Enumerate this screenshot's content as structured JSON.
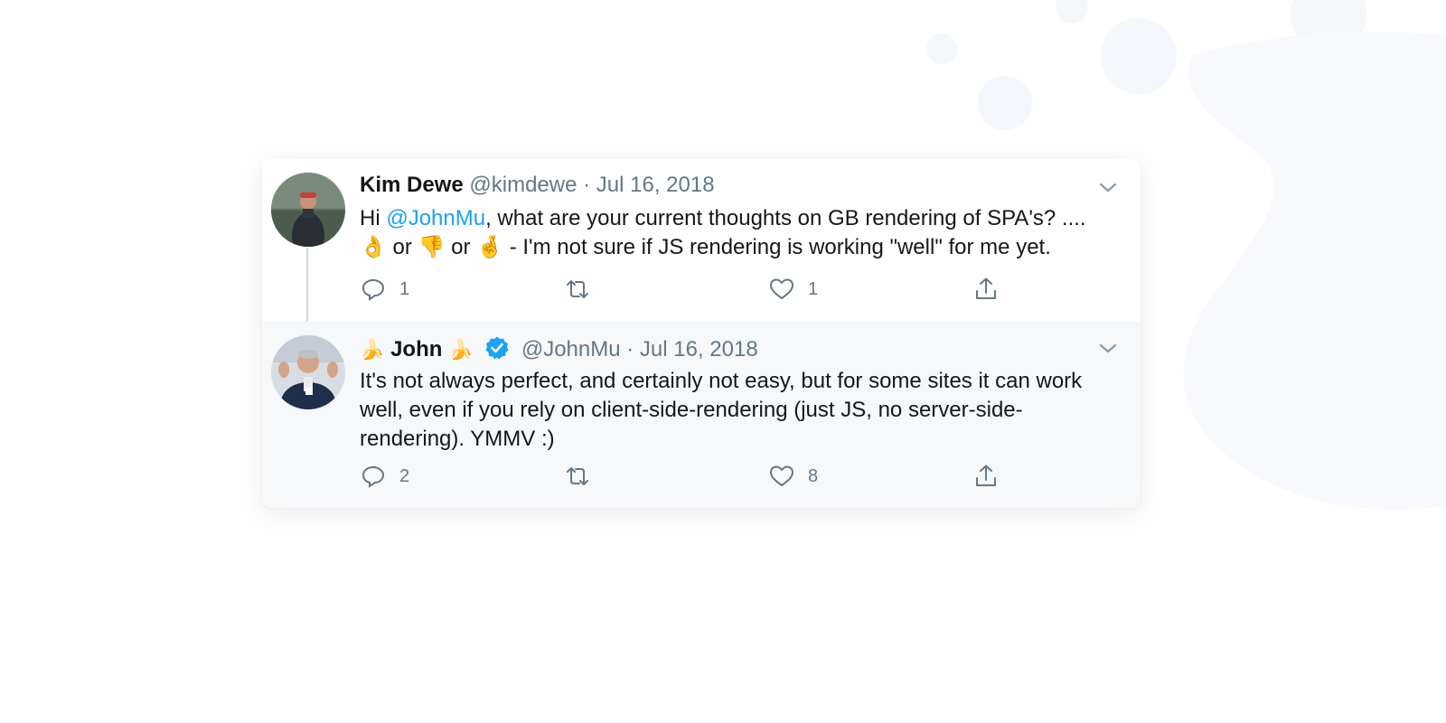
{
  "colors": {
    "link": "#1da1f2",
    "secondary_text": "#657786",
    "verified_badge": "#1da1f2",
    "reply_background": "#f6f8fa"
  },
  "tweets": [
    {
      "name": "Kim Dewe",
      "handle": "@kimdewe",
      "date": "· Jul 16, 2018",
      "text_before": "Hi ",
      "mention": "@JohnMu",
      "text_after": ", what are your current thoughts on GB rendering of SPA's? ....",
      "emoji_1": "👌",
      "or_1": " or ",
      "emoji_2": "👎",
      "or_2": " or ",
      "emoji_3": "🤞",
      "text_tail": "  - I'm not sure if JS rendering is working \"well\" for me yet.",
      "reply_count": "1",
      "retweet_count": "",
      "like_count": "1",
      "icons": [
        "reply-icon",
        "retweet-icon",
        "heart-icon",
        "share-icon",
        "chevron-down-icon"
      ]
    },
    {
      "name_prefix_emoji": "🍌",
      "name": "John",
      "name_suffix_emoji": "🍌",
      "handle": "@JohnMu",
      "date": "· Jul 16, 2018",
      "text": "It's not always perfect, and certainly not easy, but for some sites it can work well, even if you rely on client-side-rendering (just JS, no server-side-rendering). YMMV :)",
      "reply_count": "2",
      "retweet_count": "",
      "like_count": "8",
      "verified": true,
      "icons": [
        "verified-icon",
        "reply-icon",
        "retweet-icon",
        "heart-icon",
        "share-icon",
        "chevron-down-icon"
      ]
    }
  ]
}
